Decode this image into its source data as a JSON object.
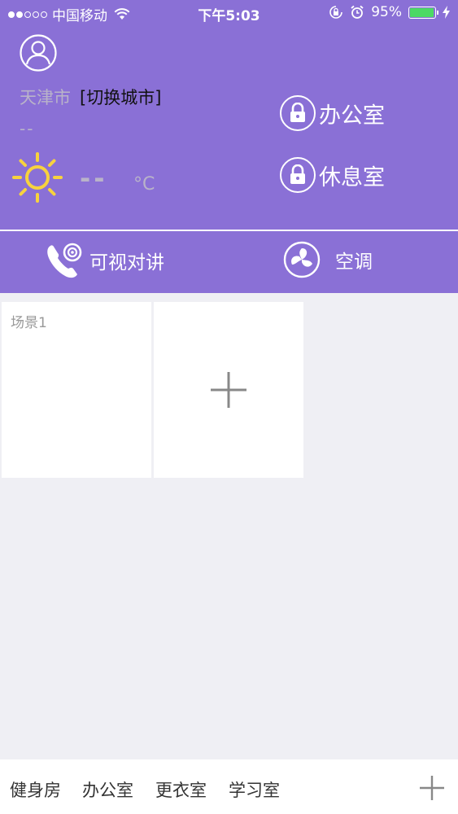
{
  "status_bar": {
    "carrier": "中国移动",
    "time": "下午5:03",
    "battery_percent": "95%",
    "battery_level": 0.95
  },
  "location": {
    "city": "天津市",
    "switch_label": "[切换城市]"
  },
  "weather": {
    "description": "--",
    "temperature": "--",
    "unit": "°C",
    "icon": "sun-icon"
  },
  "locks": [
    {
      "label": "办公室",
      "icon": "lock-icon"
    },
    {
      "label": "休息室",
      "icon": "lock-icon"
    }
  ],
  "functions": [
    {
      "label": "可视对讲",
      "icon": "intercom-phone-icon"
    },
    {
      "label": "空调",
      "icon": "air-conditioner-icon"
    }
  ],
  "scenes": [
    {
      "label": "场景1"
    }
  ],
  "rooms": [
    {
      "label": "健身房"
    },
    {
      "label": "办公室"
    },
    {
      "label": "更衣室"
    },
    {
      "label": "学习室"
    }
  ],
  "colors": {
    "header": "#8a70d6",
    "background": "#efeff4",
    "battery": "#4cd964",
    "sun": "#f7d23e"
  }
}
